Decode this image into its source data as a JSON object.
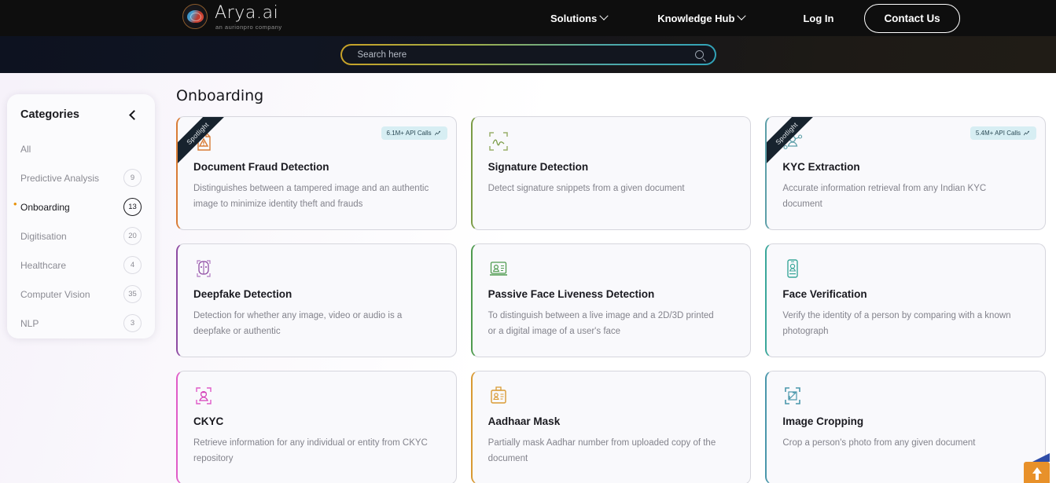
{
  "header": {
    "logo_name": "Arya.ai",
    "logo_sub": "an aurionpro company",
    "nav": [
      {
        "label": "Solutions",
        "has_caret": true
      },
      {
        "label": "Knowledge Hub",
        "has_caret": true
      },
      {
        "label": "Log In",
        "has_caret": false
      }
    ],
    "cta_label": "Contact Us"
  },
  "search": {
    "placeholder": "Search here",
    "value": "",
    "icon": "search-icon"
  },
  "sidebar": {
    "title": "Categories",
    "collapse_icon": "chevron-left-icon",
    "items": [
      {
        "label": "All",
        "count": "",
        "active": false
      },
      {
        "label": "Predictive Analysis",
        "count": "9",
        "active": false
      },
      {
        "label": "Onboarding",
        "count": "13",
        "active": true
      },
      {
        "label": "Digitisation",
        "count": "20",
        "active": false
      },
      {
        "label": "Healthcare",
        "count": "4",
        "active": false
      },
      {
        "label": "Computer Vision",
        "count": "35",
        "active": false
      },
      {
        "label": "NLP",
        "count": "3",
        "active": false
      }
    ]
  },
  "main": {
    "page_title": "Onboarding",
    "ribbon_label": "Spotlight",
    "cards": [
      {
        "title": "Document Fraud Detection",
        "desc": "Distinguishes between a tampered image and an authentic image to minimize identity theft and frauds",
        "icon": "document-warning-icon",
        "accent": "#d97c36",
        "spotlight": true,
        "api_calls": "6.1M+ API Calls"
      },
      {
        "title": "Signature Detection",
        "desc": "Detect signature snippets from a given document",
        "icon": "signature-scan-icon",
        "accent": "#7a9b46",
        "spotlight": false,
        "api_calls": ""
      },
      {
        "title": "KYC Extraction",
        "desc": "Accurate information retrieval from any Indian KYC document",
        "icon": "person-network-icon",
        "accent": "#5d9fa8",
        "spotlight": true,
        "api_calls": "5.4M+ API Calls"
      },
      {
        "title": "Deepfake Detection",
        "desc": "Detection for whether any image, video or audio is a deepfake or authentic",
        "icon": "deepfake-face-icon",
        "accent": "#8e4ba3",
        "spotlight": false,
        "api_calls": ""
      },
      {
        "title": "Passive Face Liveness Detection",
        "desc": "To distinguish between a live image and a 2D/3D printed or a digital image of a user's face",
        "icon": "liveness-card-icon",
        "accent": "#4f9b4f",
        "spotlight": false,
        "api_calls": ""
      },
      {
        "title": "Face Verification",
        "desc": "Verify the identity of a person by comparing with a known photograph",
        "icon": "face-phone-icon",
        "accent": "#3aa79a",
        "spotlight": false,
        "api_calls": ""
      },
      {
        "title": "CKYC",
        "desc": "Retrieve information for any individual or entity from CKYC repository",
        "icon": "face-scan-icon",
        "accent": "#e05cc8",
        "spotlight": false,
        "api_calls": ""
      },
      {
        "title": "Aadhaar Mask",
        "desc": "Partially mask Aadhar number from uploaded copy of the document",
        "icon": "id-card-icon",
        "accent": "#d99a33",
        "spotlight": false,
        "api_calls": ""
      },
      {
        "title": "Image Cropping",
        "desc": "Crop a person's photo from any given document",
        "icon": "crop-scan-icon",
        "accent": "#4a97ab",
        "spotlight": false,
        "api_calls": ""
      }
    ]
  },
  "floating": {
    "scroll_top_icon": "arrow-up-icon",
    "accent": "#e8912a"
  }
}
